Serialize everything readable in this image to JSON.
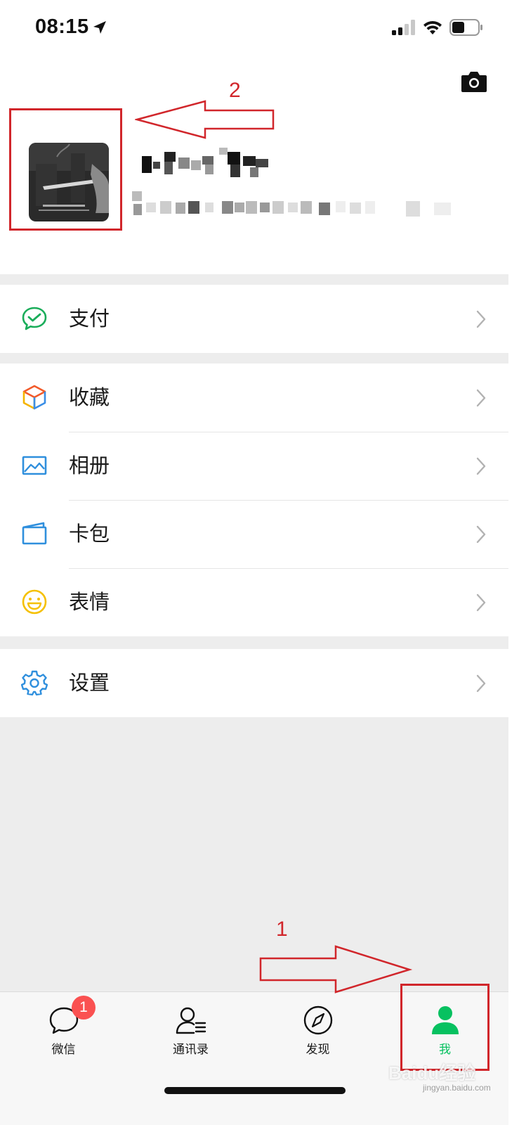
{
  "status_bar": {
    "time": "08:15"
  },
  "menu": {
    "pay": {
      "label": "支付",
      "icon": "wechat-pay-icon"
    },
    "favorites": {
      "label": "收藏",
      "icon": "favorites-cube-icon"
    },
    "album": {
      "label": "相册",
      "icon": "album-picture-icon"
    },
    "cards": {
      "label": "卡包",
      "icon": "card-wallet-icon"
    },
    "stickers": {
      "label": "表情",
      "icon": "smiley-sticker-icon"
    },
    "settings": {
      "label": "设置",
      "icon": "gear-icon"
    }
  },
  "tabbar": {
    "chats": {
      "label": "微信",
      "badge": "1"
    },
    "contacts": {
      "label": "通讯录"
    },
    "discover": {
      "label": "发现"
    },
    "me": {
      "label": "我"
    }
  },
  "annotations": {
    "label_1": "1",
    "label_2": "2"
  },
  "watermark": {
    "brand": "Baidu经验",
    "url": "jingyan.baidu.com"
  },
  "colors": {
    "accent_green": "#07c160",
    "annotation_red": "#d1262b",
    "badge_red": "#fa5151",
    "page_background": "#ededed"
  }
}
